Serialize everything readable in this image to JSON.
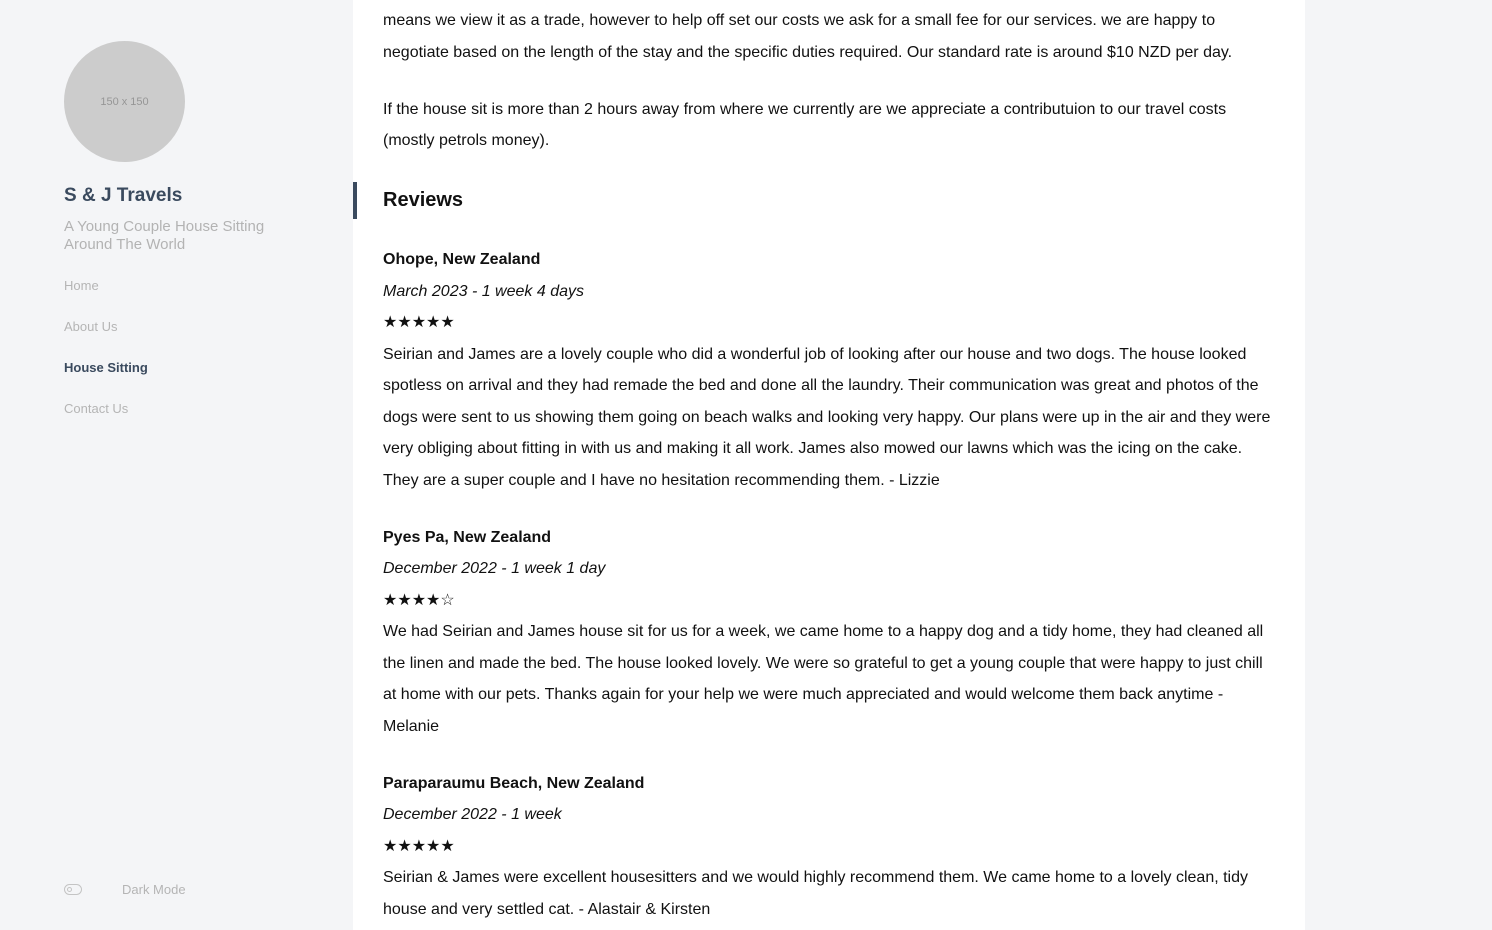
{
  "sidebar": {
    "avatar_text": "150 x 150",
    "site_title": "S & J Travels",
    "site_subtitle": "A Young Couple House Sitting Around The World",
    "nav": [
      {
        "label": "Home",
        "active": false
      },
      {
        "label": "About Us",
        "active": false
      },
      {
        "label": "House Sitting",
        "active": true
      },
      {
        "label": "Contact Us",
        "active": false
      }
    ],
    "dark_mode_label": "Dark Mode"
  },
  "main": {
    "intro_paragraphs": [
      "means we view it as a trade, however to help off set our costs we ask for a small fee for our services. we are happy to negotiate based on the length of the stay and the specific duties required. Our standard rate is around $10 NZD per day.",
      "If the house sit is more than 2 hours away from where we currently are we appreciate a contributuion to our travel costs (mostly petrols money)."
    ],
    "reviews_heading": "Reviews",
    "reviews": [
      {
        "location": "Ohope, New Zealand",
        "date": "March 2023 - 1 week 4 days",
        "stars": "★★★★★",
        "rating": 5,
        "text": "Seirian and James are a lovely couple who did a wonderful job of looking after our house and two dogs. The house looked spotless on arrival and they had remade the bed and done all the laundry. Their communication was great and photos of the dogs were sent to us showing them going on beach walks and looking very happy. Our plans were up in the air and they were very obliging about fitting in with us and making it all work. James also mowed our lawns which was the icing on the cake. They are a super couple and I have no hesitation recommending them. - Lizzie"
      },
      {
        "location": "Pyes Pa, New Zealand",
        "date": "December 2022 - 1 week 1 day",
        "stars": "★★★★☆",
        "rating": 4,
        "text": "We had Seirian and James house sit for us for a week, we came home to a happy dog and a tidy home, they had cleaned all the linen and made the bed. The house looked lovely. We were so grateful to get a young couple that were happy to just chill at home with our pets. Thanks again for your help we were much appreciated and would welcome them back anytime - Melanie"
      },
      {
        "location": "Paraparaumu Beach, New Zealand",
        "date": "December 2022 - 1 week",
        "stars": "★★★★★",
        "rating": 5,
        "text": "Seirian & James were excellent housesitters and we would highly recommend them. We came home to a lovely clean, tidy house and very settled cat. - Alastair & Kirsten"
      }
    ]
  }
}
